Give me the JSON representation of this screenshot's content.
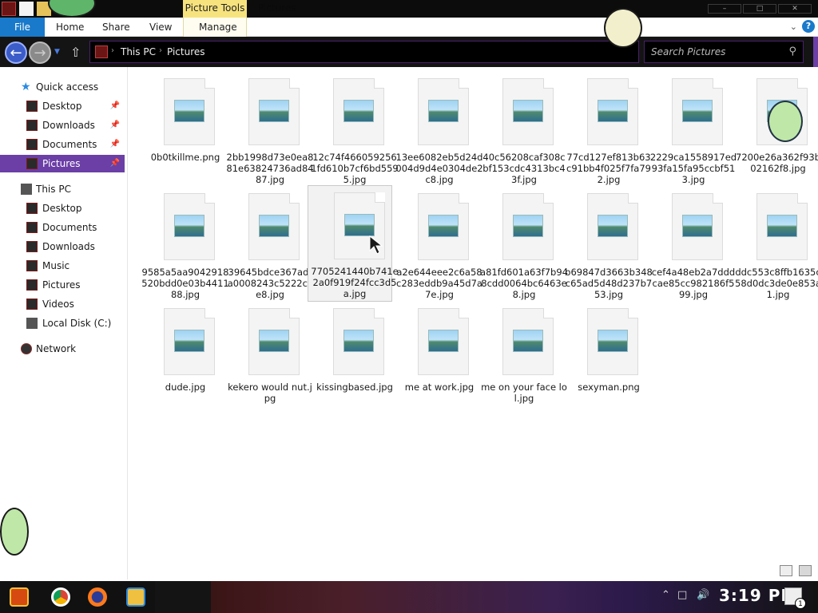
{
  "window": {
    "title": "Pictures",
    "picture_tools": "Picture Tools",
    "controls": [
      "–",
      "□",
      "✕"
    ]
  },
  "ribbon": {
    "tabs": [
      "File",
      "Home",
      "Share",
      "View",
      "Manage"
    ],
    "help": "?"
  },
  "address": {
    "crumbs": [
      "This PC",
      "Pictures"
    ]
  },
  "search": {
    "placeholder": "Search Pictures"
  },
  "sidebar": {
    "quick_access": "Quick access",
    "quick_items": [
      "Desktop",
      "Downloads",
      "Documents",
      "Pictures"
    ],
    "this_pc": "This PC",
    "pc_items": [
      "Desktop",
      "Documents",
      "Downloads",
      "Music",
      "Pictures",
      "Videos",
      "Local Disk (C:)"
    ],
    "network": "Network"
  },
  "files": [
    {
      "name": "0b0tkillme.png"
    },
    {
      "name": "2bb1998d73e0ea881e63824736ad8487.jpg"
    },
    {
      "name": "12c74f4660592561fd610b7cf6bd5595.jpg"
    },
    {
      "name": "13ee6082eb5d24d004d9d4e0304de2c8.jpg"
    },
    {
      "name": "40c56208caf308cbf153cdc4313bc43f.jpg"
    },
    {
      "name": "77cd127ef813b63c91bb4f025f7fa792.jpg"
    },
    {
      "name": "2229ca1558917ed93fa15fa95ccbf513.jpg"
    },
    {
      "name": "7200e26a362f93b02162f8.jpg"
    },
    {
      "name": "9585a5aa9042918520bdd0e03b441188.jpg"
    },
    {
      "name": "39645bdce367adfa0008243c5222cce8.jpg"
    },
    {
      "name": "7705241440b741e2a0f919f24fcc3d5a.jpg"
    },
    {
      "name": "a2e644eee2c6a58c283eddb9a45d7a7e.jpg"
    },
    {
      "name": "a81fd601a63f7b948cdd0064bc6463e8.jpg"
    },
    {
      "name": "b69847d3663b348c65ad5d48d237b753.jpg"
    },
    {
      "name": "cef4a48eb2a7dddcae85cc982186f599.jpg"
    },
    {
      "name": "ddc553c8ffb1635c58d0dc3de0e853a1.jpg"
    },
    {
      "name": "dude.jpg"
    },
    {
      "name": "kekero would nut.jpg"
    },
    {
      "name": "kissingbased.jpg"
    },
    {
      "name": "me at work.jpg"
    },
    {
      "name": "me on your face lol.jpg"
    },
    {
      "name": "sexyman.png"
    }
  ],
  "taskbar": {
    "clock": "3:19 PM",
    "notifications": "1"
  },
  "colors": {
    "accent": "#6b3fa6",
    "file_tab": "#1979ca",
    "picture_tools": "#f6e37e"
  }
}
